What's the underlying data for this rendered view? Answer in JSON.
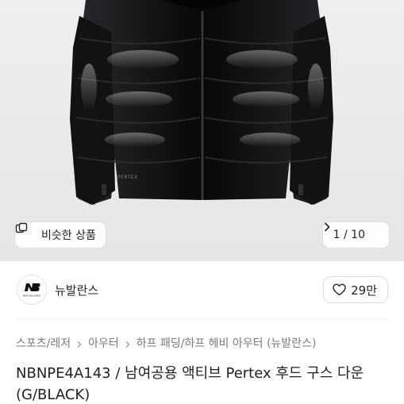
{
  "image_viewer": {
    "similar_button_label": "비슷한 상품",
    "pager_text": "1 / 10"
  },
  "seller": {
    "logo_text": "NEW BALANCE",
    "name": "뉴발란스",
    "like_count": "29만"
  },
  "product": {
    "categories": [
      "스포츠/레저",
      "아우터",
      "하프 패딩/하프 헤비 아우터 (뉴발란스)"
    ],
    "title": "NBNPE4A143 / 남여공용 액티브 Pertex 후드 구스 다운 (G/BLACK)",
    "jacket_logo_text": "PERTEX"
  },
  "colors": {
    "jacket": "#0c0c0e",
    "background": "#ececec"
  }
}
